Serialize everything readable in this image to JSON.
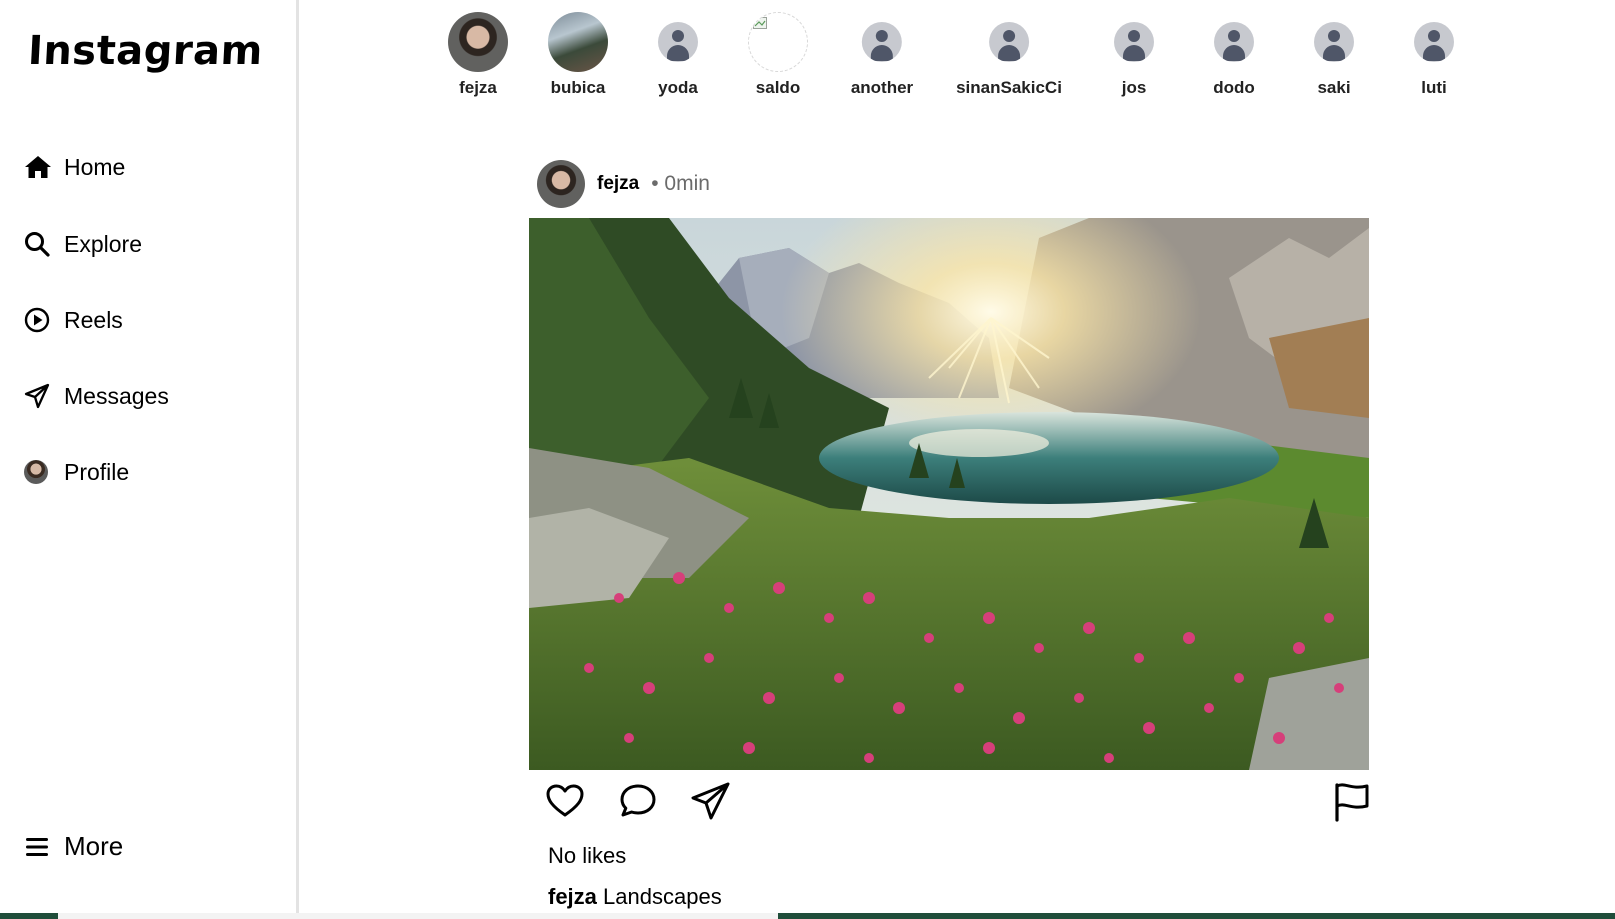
{
  "app": {
    "logo": "Instagram"
  },
  "sidebar": {
    "items": [
      {
        "label": "Home",
        "icon": "home-icon"
      },
      {
        "label": "Explore",
        "icon": "search-icon"
      },
      {
        "label": "Reels",
        "icon": "play-circle-icon"
      },
      {
        "label": "Messages",
        "icon": "paper-plane-icon"
      },
      {
        "label": "Profile",
        "icon": "avatar"
      }
    ],
    "more_label": "More"
  },
  "stories": [
    {
      "name": "fejza",
      "avatar": "photo"
    },
    {
      "name": "bubica",
      "avatar": "photo"
    },
    {
      "name": "yoda",
      "avatar": "placeholder"
    },
    {
      "name": "saldo",
      "avatar": "broken-image"
    },
    {
      "name": "another",
      "avatar": "placeholder"
    },
    {
      "name": "sinanSakicCi",
      "avatar": "placeholder"
    },
    {
      "name": "jos",
      "avatar": "placeholder"
    },
    {
      "name": "dodo",
      "avatar": "placeholder"
    },
    {
      "name": "saki",
      "avatar": "placeholder"
    },
    {
      "name": "luti",
      "avatar": "placeholder"
    }
  ],
  "post": {
    "username": "fejza",
    "time": "• 0min",
    "likes_text": "No likes",
    "caption_user": "fejza",
    "caption_text": "Landscapes",
    "actions": [
      "heart-icon",
      "comment-icon",
      "share-icon",
      "flag-icon"
    ]
  },
  "colors": {
    "placeholder_bg": "#c7c9cf",
    "placeholder_fg": "#4f5668",
    "divider": "#e3e3e3"
  }
}
